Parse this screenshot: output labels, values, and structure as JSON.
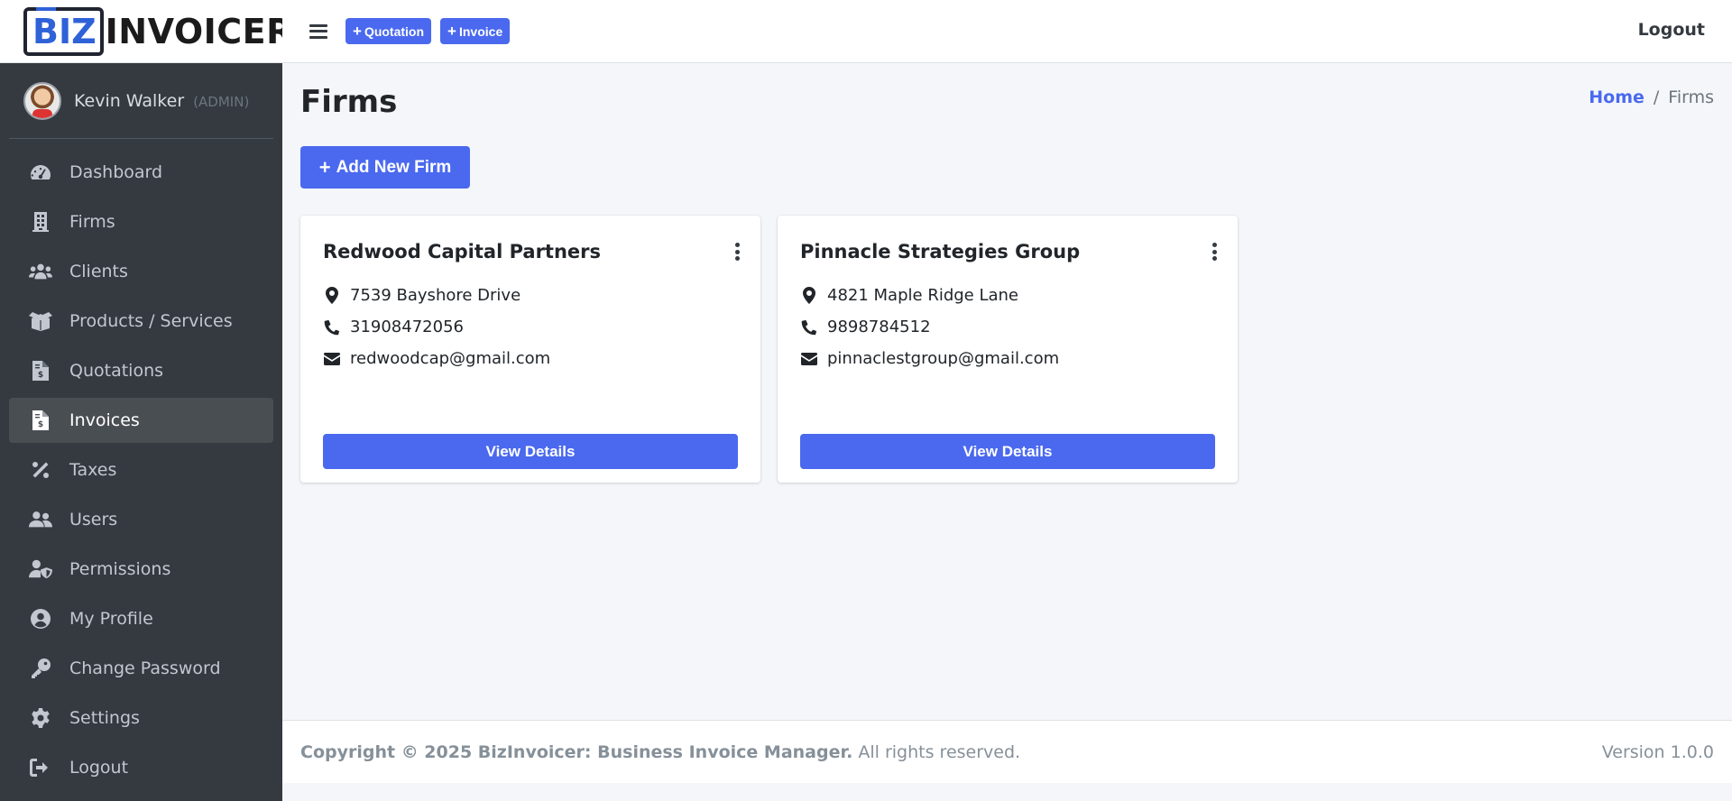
{
  "brand": {
    "biz": "BIZ",
    "rest": "INVOICER"
  },
  "user": {
    "name": "Kevin Walker",
    "role": "(ADMIN)"
  },
  "sidebar": {
    "items": [
      {
        "label": "Dashboard",
        "icon": "gauge-icon"
      },
      {
        "label": "Firms",
        "icon": "building-icon"
      },
      {
        "label": "Clients",
        "icon": "users-icon"
      },
      {
        "label": "Products / Services",
        "icon": "boxes-icon"
      },
      {
        "label": "Quotations",
        "icon": "file-invoice-dollar-icon"
      },
      {
        "label": "Invoices",
        "icon": "file-invoice-dollar-icon",
        "active": true
      },
      {
        "label": "Taxes",
        "icon": "percent-icon"
      },
      {
        "label": "Users",
        "icon": "user-group-icon"
      },
      {
        "label": "Permissions",
        "icon": "user-shield-icon"
      },
      {
        "label": "My Profile",
        "icon": "user-circle-icon"
      },
      {
        "label": "Change Password",
        "icon": "key-icon"
      },
      {
        "label": "Settings",
        "icon": "gear-icon"
      },
      {
        "label": "Logout",
        "icon": "sign-out-icon"
      }
    ]
  },
  "topbar": {
    "quotation_label": "Quotation",
    "invoice_label": "Invoice",
    "logout_label": "Logout"
  },
  "page": {
    "title": "Firms",
    "breadcrumb": {
      "home": "Home",
      "separator": "/",
      "current": "Firms"
    },
    "add_button": "Add New Firm"
  },
  "firms": [
    {
      "name": "Redwood Capital Partners",
      "address": "7539 Bayshore Drive",
      "phone": "31908472056",
      "email": "redwoodcap@gmail.com",
      "button": "View Details"
    },
    {
      "name": "Pinnacle Strategies Group",
      "address": "4821 Maple Ridge Lane",
      "phone": "9898784512",
      "email": "pinnaclestgroup@gmail.com",
      "button": "View Details"
    }
  ],
  "footer": {
    "copyright": "Copyright © 2025 BizInvoicer: Business Invoice Manager.",
    "rights": "All rights reserved.",
    "version": "Version 1.0.0"
  },
  "colors": {
    "accent": "#4a69ef",
    "sidebar": "#343a40",
    "sidebar_active": "#494e53"
  }
}
